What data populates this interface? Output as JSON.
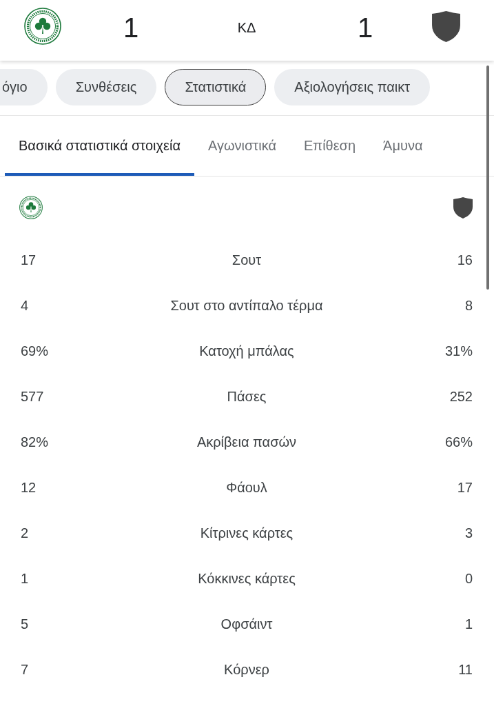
{
  "match_header": {
    "home_score": "1",
    "status": "ΚΔ",
    "away_score": "1"
  },
  "section_tabs": [
    {
      "label": "όγιο",
      "selected": false
    },
    {
      "label": "Συνθέσεις",
      "selected": false
    },
    {
      "label": "Στατιστικά",
      "selected": true
    },
    {
      "label": "Αξιολογήσεις παικτ",
      "selected": false
    }
  ],
  "stat_tabs": [
    {
      "label": "Βασικά στατιστικά στοιχεία",
      "selected": true
    },
    {
      "label": "Αγωνιστικά",
      "selected": false
    },
    {
      "label": "Επίθεση",
      "selected": false
    },
    {
      "label": "Άμυνα",
      "selected": false
    }
  ],
  "stats": [
    {
      "home": "17",
      "label": "Σουτ",
      "away": "16"
    },
    {
      "home": "4",
      "label": "Σουτ στο αντίπαλο τέρμα",
      "away": "8"
    },
    {
      "home": "69%",
      "label": "Κατοχή μπάλας",
      "away": "31%"
    },
    {
      "home": "577",
      "label": "Πάσες",
      "away": "252"
    },
    {
      "home": "82%",
      "label": "Ακρίβεια πασών",
      "away": "66%"
    },
    {
      "home": "12",
      "label": "Φάουλ",
      "away": "17"
    },
    {
      "home": "2",
      "label": "Κίτρινες κάρτες",
      "away": "3"
    },
    {
      "home": "1",
      "label": "Κόκκινες κάρτες",
      "away": "0"
    },
    {
      "home": "5",
      "label": "Οφσάιντ",
      "away": "1"
    },
    {
      "home": "7",
      "label": "Κόρνερ",
      "away": "11"
    }
  ]
}
